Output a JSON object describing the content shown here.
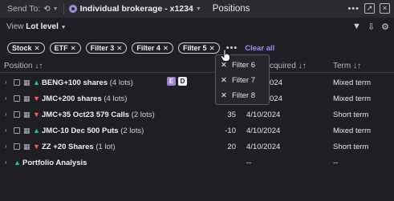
{
  "topbar": {
    "send_to_label": "Send To:",
    "account_name": "Individual brokerage - x1234",
    "title": "Positions",
    "more_glyph": "•••",
    "send_btn": "↗",
    "close_btn": "×"
  },
  "view": {
    "label": "View",
    "value": "Lot level"
  },
  "filters": {
    "chips": [
      "Stock",
      "ETF",
      "Filter 3",
      "Filter 4",
      "Filter 5"
    ],
    "more_glyph": "•••",
    "clear_all": "Clear all",
    "overflow_menu": [
      "Filter 6",
      "Filter 7",
      "Filter 8"
    ]
  },
  "table": {
    "headers": {
      "position": "Position",
      "acquired": "cquired",
      "term": "Term"
    },
    "rows": [
      {
        "symbol": "BENG+100 shares",
        "lots": "(4 lots)",
        "direction": "up",
        "qty": "",
        "date": "024",
        "term": "Mixed term",
        "badges": [
          "E",
          "D"
        ]
      },
      {
        "symbol": "JMC+200 shares",
        "lots": "(4 lots)",
        "direction": "down",
        "qty": "",
        "date": "024",
        "term": "Mixed term"
      },
      {
        "symbol": "JMC+35 Oct23 579 Calls",
        "lots": "(2 lots)",
        "direction": "down",
        "qty": "35",
        "date": "4/10/2024",
        "term": "Short term"
      },
      {
        "symbol": "JMC-10 Dec 500 Puts",
        "lots": "(2 lots)",
        "direction": "up",
        "qty": "-10",
        "date": "4/10/2024",
        "term": "Mixed term"
      },
      {
        "symbol": "ZZ +20 Shares",
        "lots": "(1 lot)",
        "direction": "down",
        "qty": "20",
        "date": "4/10/2024",
        "term": "Short term"
      },
      {
        "symbol": "Portfolio Analysis",
        "lots": "",
        "direction": "up",
        "qty": "",
        "date": "--",
        "term": "--"
      }
    ]
  },
  "colors": {
    "accent": "#a58cff",
    "up": "#27c28b",
    "down": "#ff5a5a",
    "background": "#1f1f23"
  }
}
